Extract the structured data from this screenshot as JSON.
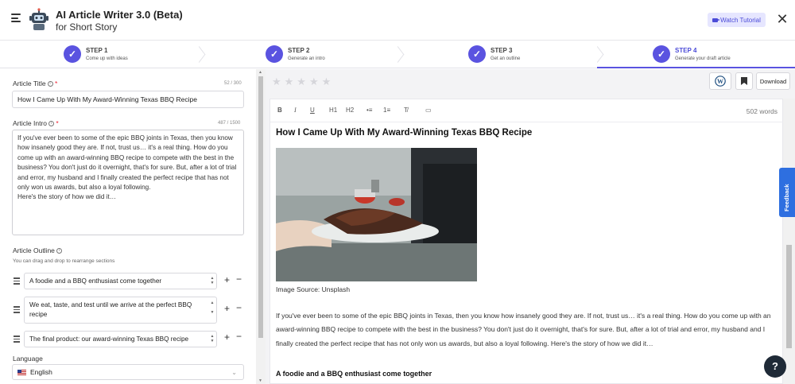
{
  "header": {
    "title": "AI Article Writer 3.0 (Beta)",
    "subtitle": "for Short Story",
    "watch_tutorial": "Watch Tutorial",
    "close": "✕"
  },
  "steps": [
    {
      "label": "STEP 1",
      "desc": "Come up with ideas",
      "state": "done"
    },
    {
      "label": "STEP 2",
      "desc": "Generate an intro",
      "state": "done"
    },
    {
      "label": "STEP 3",
      "desc": "Get an outline",
      "state": "done"
    },
    {
      "label": "STEP 4",
      "desc": "Generate your draft article",
      "state": "active"
    }
  ],
  "form": {
    "title_label": "Article Title",
    "title_counter": "52 / 300",
    "title_value": "How I Came Up With My Award-Winning Texas BBQ Recipe",
    "intro_label": "Article Intro",
    "intro_counter": "487 / 1500",
    "intro_value": "If you've ever been to some of the epic BBQ joints in Texas, then you know how insanely good they are. If not, trust us… it's a real thing. How do you come up with an award-winning BBQ recipe to compete with the best in the business? You don't just do it overnight, that's for sure. But, after a lot of trial and error, my husband and I finally created the perfect recipe that has not only won us awards, but also a loyal following.\nHere's the story of how we did it…",
    "outline_label": "Article Outline",
    "outline_help": "You can drag and drop to rearrange sections",
    "outline_items": [
      "A foodie and a BBQ enthusiast come together",
      "We eat, taste, and test until we arrive at the perfect BBQ recipe",
      "The final product: our award-winning Texas BBQ recipe"
    ],
    "language_label": "Language",
    "language_value": "English"
  },
  "toolbar": {
    "rating_stars": "★★★★★",
    "download": "Download",
    "word_count": "502 words",
    "tools": [
      "B",
      "I",
      "U",
      "H1",
      "H2",
      "•≡",
      "1≡",
      "T̸",
      "▭"
    ]
  },
  "article": {
    "heading": "How I Came Up With My Award-Winning Texas BBQ Recipe",
    "image_caption": "Image Source: Unsplash",
    "paragraph": "If you've ever been to some of the epic BBQ joints in Texas, then you know how insanely good they are. If not, trust us… it's a real thing. How do you come up with an award-winning BBQ recipe to compete with the best in the business? You don't just do it overnight, that's for sure. But, after a lot of trial and error, my husband and I finally created the perfect recipe that has not only won us awards, but also a loyal following. Here's the story of how we did it…",
    "subheading": "A foodie and a BBQ enthusiast come together"
  },
  "feedback": "Feedback",
  "help": "?",
  "colors": {
    "accent": "#5a53e0",
    "feedback": "#2e6fe0"
  }
}
